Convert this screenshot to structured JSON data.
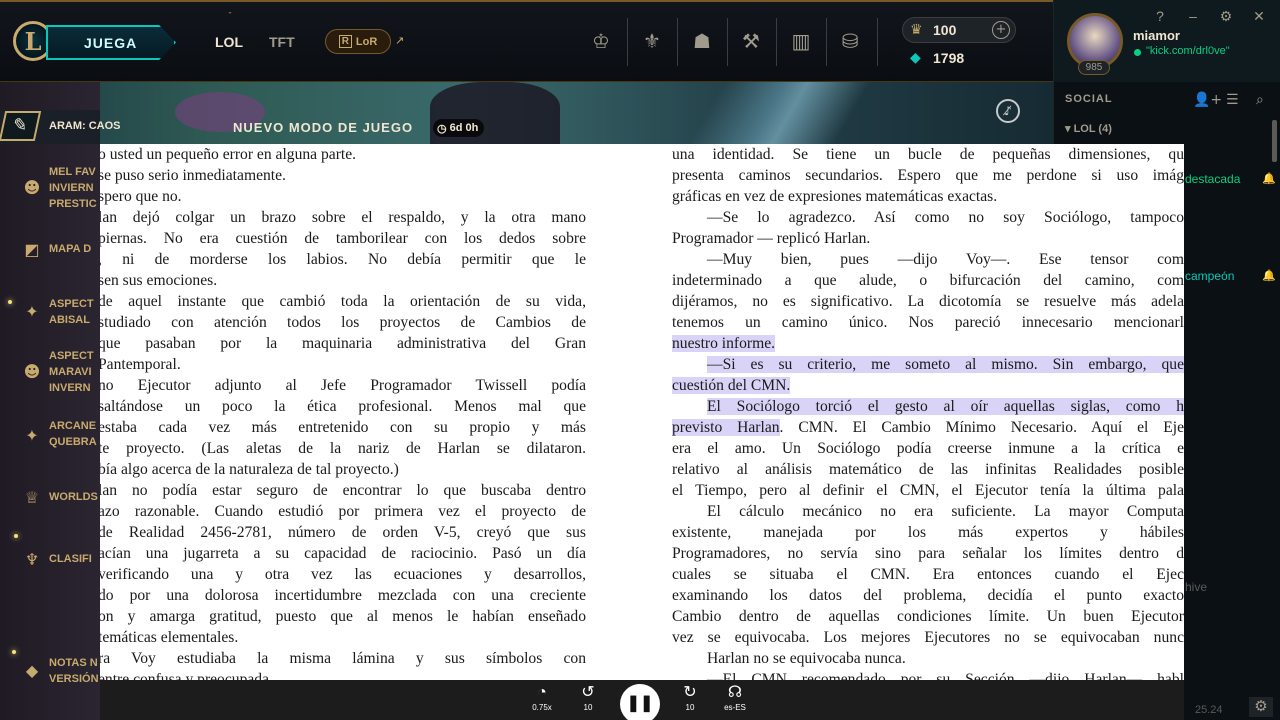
{
  "topbar": {
    "logo_letter": "L",
    "play_label": "JUEGA",
    "nav_lol": "LOL",
    "nav_tft": "TFT",
    "lor_label": "LoR",
    "lor_icon_letter": "R",
    "currency_rp": "100",
    "currency_be": "1798"
  },
  "profile": {
    "username": "miamor",
    "status": "\"kick.com/drl0ve\"",
    "level": "985"
  },
  "window_controls": [
    "?",
    "–",
    "⚙",
    "✕"
  ],
  "social": {
    "title": "SOCIAL",
    "group_label": "LOL (4)",
    "fragments": [
      "destacada",
      "campeón",
      "hive"
    ],
    "version": "25.24"
  },
  "banner": {
    "mode_label": "NUEVO MODO DE JUEGO",
    "timer": "6d 0h"
  },
  "sidebar": {
    "items": [
      {
        "label": "ARAM: CAOS",
        "icon": "aram-icon"
      },
      {
        "label": "MEL FAV\nINVIERN\nPRESTIC",
        "icon": "mask-icon"
      },
      {
        "label": "MAPA D",
        "icon": "map-icon"
      },
      {
        "label": "ASPECT\nABISAL",
        "icon": "sparkle-icon"
      },
      {
        "label": "ASPECT\nMARAVI\nINVERN",
        "icon": "mask-icon"
      },
      {
        "label": "ARCANE\nQUEBRA",
        "icon": "sparkle-icon"
      },
      {
        "label": "WORLDS",
        "icon": "worlds-icon"
      },
      {
        "label": "CLASIFI",
        "icon": "ranked-icon"
      },
      {
        "label": "NOTAS N\nVERSIÓN",
        "icon": "diamond-icon"
      }
    ]
  },
  "book": {
    "left_page": [
      {
        "t": "o usted un pequeño error en alguna parte.",
        "last": true
      },
      {
        "t": "se puso serio inmediatamente.",
        "last": true
      },
      {
        "t": "spero que no.",
        "last": true
      },
      {
        "t": "lan dejó colgar un brazo sobre el respaldo, y la otra mano"
      },
      {
        "t": "piernas. No era cuestión de tamborilear con los dedos sobre"
      },
      {
        "t": ", ni de morderse los labios. No debía permitir que le"
      },
      {
        "t": "sen sus emociones.",
        "last": true
      },
      {
        "t": "de aquel instante que cambió toda la orientación de su vida,"
      },
      {
        "t": "studiado con atención todos los proyectos de Cambios de"
      },
      {
        "t": "que pasaban por la maquinaria administrativa del Gran"
      },
      {
        "t": "Pantemporal.",
        "last": true
      },
      {
        "t": "no Ejecutor adjunto al Jefe Programador Twissell podía"
      },
      {
        "t": "saltándose un poco la ética profesional. Menos mal que"
      },
      {
        "t": "estaba cada vez más entretenido con su propio y más"
      },
      {
        "t": "te proyecto. (Las aletas de la nariz de Harlan se dilataron."
      },
      {
        "t": "bía algo acerca de la naturaleza de tal proyecto.)",
        "last": true
      },
      {
        "t": "lan no podía estar seguro de encontrar lo que buscaba dentro"
      },
      {
        "t": "azo razonable. Cuando estudió por primera vez el proyecto de"
      },
      {
        "t": "de Realidad 2456-2781, número de orden V-5, creyó que sus"
      },
      {
        "t": "acían una jugarreta a su capacidad de raciocinio. Pasó un día"
      },
      {
        "t": "verificando una y otra vez las ecuaciones y desarrollos,"
      },
      {
        "t": "do por una dolorosa incertidumbre mezclada con una creciente"
      },
      {
        "t": "on y amarga gratitud, puesto que al menos le habían enseñado"
      },
      {
        "t": "temáticas elementales.",
        "last": true
      },
      {
        "t": "ra Voy estudiaba la misma lámina y sus símbolos con"
      },
      {
        "t": "entre confusa y preocupada.",
        "last": true
      }
    ],
    "right_page": [
      {
        "t": "una identidad. Se tiene un bucle de pequeñas dimensiones, qu"
      },
      {
        "t": "presenta caminos secundarios. Espero que me perdone si uso imág"
      },
      {
        "t": "gráficas en vez de expresiones matemáticas exactas.",
        "last": true
      },
      {
        "t": "—Se lo agradezco. Así como no soy Sociólogo, tampoco",
        "ind": true
      },
      {
        "t": "Programador — replicó Harlan.",
        "last": true
      },
      {
        "t": "—Muy bien, pues —dijo Voy—. Ese tensor com",
        "ind": true
      },
      {
        "t": "indeterminado a que alude, o bifurcación del camino, com"
      },
      {
        "t": "dijéramos, no es significativo. La dicotomía se resuelve más adela"
      },
      {
        "t": "tenemos un camino único. Nos pareció innecesario mencionarl"
      },
      {
        "t": "nuestro informe.",
        "last": true,
        "hl": "all"
      },
      {
        "t": "—Si es su criterio, me someto al mismo. Sin embargo, que",
        "ind": true,
        "hl": "all"
      },
      {
        "t": "cuestión del CMN.",
        "last": true,
        "hl": "all"
      },
      {
        "t": "El Sociólogo torció el gesto al oír aquellas siglas, como h",
        "ind": true,
        "hl": "all"
      },
      {
        "t": "previsto Harlan. CMN. El Cambio Mínimo Necesario. Aquí el Eje",
        "hl": "prefix",
        "hl_text": "previsto Harlan"
      },
      {
        "t": "era el amo. Un Sociólogo podía creerse inmune a la crítica e"
      },
      {
        "t": "relativo al análisis matemático de las infinitas Realidades posible"
      },
      {
        "t": "el Tiempo, pero al definir el CMN, el Ejecutor tenía la última pala"
      },
      {
        "t": "El cálculo mecánico no era suficiente. La mayor Computa",
        "ind": true
      },
      {
        "t": "existente, manejada por los más expertos y hábiles"
      },
      {
        "t": "Programadores, no servía sino para señalar los límites dentro d"
      },
      {
        "t": "cuales se situaba el CMN. Era entonces cuando el Ejec"
      },
      {
        "t": "examinando los datos del problema, decidía el punto exacto"
      },
      {
        "t": "Cambio dentro de aquellas condiciones límite. Un buen Ejecutor"
      },
      {
        "t": "vez se equivocaba. Los mejores Ejecutores no se equivocaban nunc"
      },
      {
        "t": "Harlan no se equivocaba nunca.",
        "ind": true,
        "last": true
      },
      {
        "t": "—El CMN recomendado por su Sección —dijo Harlan— habl",
        "ind": true
      }
    ]
  },
  "player": {
    "speed_label": "0.75x",
    "rewind_label": "10",
    "forward_label": "10",
    "voice_label": "es-ES"
  },
  "colors": {
    "gold": "#c8aa6e",
    "teal": "#0ac8b9",
    "highlight": "#d9d4f7",
    "online": "#0acf83"
  }
}
